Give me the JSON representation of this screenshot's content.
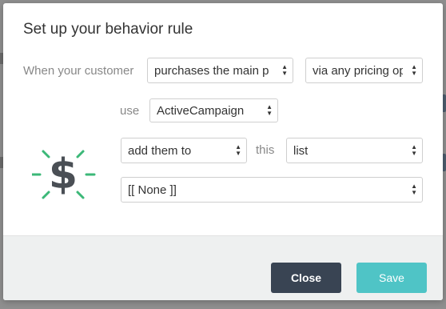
{
  "modal": {
    "title": "Set up your behavior rule"
  },
  "rule": {
    "when_label": "When your customer",
    "trigger_select": "purchases the main p",
    "pricing_select": "via any pricing op",
    "use_label": "use",
    "integration_select": "ActiveCampaign",
    "action_select": "add them to",
    "this_label": "this",
    "target_type_select": "list",
    "target_value_select": "[[ None ]]"
  },
  "footer": {
    "close_label": "Close",
    "save_label": "Save"
  },
  "icons": {
    "rule_icon": "dollar-burst-icon",
    "dropdown_icon": "updown-caret-icon"
  },
  "colors": {
    "close_button": "#394453",
    "save_button": "#4fc4c6",
    "icon_dollar": "#4a4f55",
    "icon_rays": "#3cb878"
  }
}
